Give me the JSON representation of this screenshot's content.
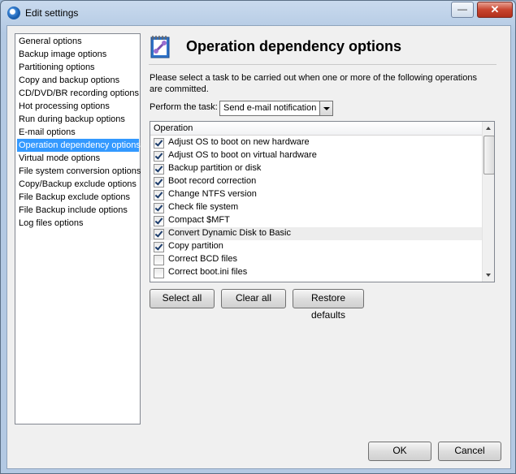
{
  "window": {
    "title": "Edit settings",
    "minimize_symbol": "—",
    "close_symbol": "✕"
  },
  "sidebar": {
    "items": [
      "General options",
      "Backup image options",
      "Partitioning options",
      "Copy and backup options",
      "CD/DVD/BR recording options",
      "Hot processing options",
      "Run during backup options",
      "E-mail options",
      "Operation dependency options",
      "Virtual mode options",
      "File system conversion options",
      "Copy/Backup exclude options",
      "File Backup exclude options",
      "File Backup include options",
      "Log files options"
    ],
    "selected_index": 8
  },
  "header": {
    "title": "Operation dependency options",
    "icon": "dependency-icon"
  },
  "description": "Please select a task to be carried out when one or more of the following operations are committed.",
  "perform": {
    "label": "Perform the task:",
    "value": "Send e-mail notification"
  },
  "operations": {
    "column": "Operation",
    "rows": [
      {
        "label": "Adjust OS to boot on new hardware",
        "checked": true
      },
      {
        "label": "Adjust OS to boot on virtual hardware",
        "checked": true
      },
      {
        "label": "Backup partition or disk",
        "checked": true
      },
      {
        "label": "Boot record correction",
        "checked": true
      },
      {
        "label": "Change NTFS version",
        "checked": true
      },
      {
        "label": "Check file system",
        "checked": true
      },
      {
        "label": "Compact $MFT",
        "checked": true
      },
      {
        "label": "Convert Dynamic Disk to Basic",
        "checked": true
      },
      {
        "label": "Copy partition",
        "checked": true
      },
      {
        "label": "Correct BCD files",
        "checked": false
      },
      {
        "label": "Correct boot.ini files",
        "checked": false
      }
    ],
    "hover_index": 7
  },
  "buttons": {
    "select_all": "Select all",
    "clear_all": "Clear all",
    "restore_defaults": "Restore defaults",
    "ok": "OK",
    "cancel": "Cancel"
  }
}
